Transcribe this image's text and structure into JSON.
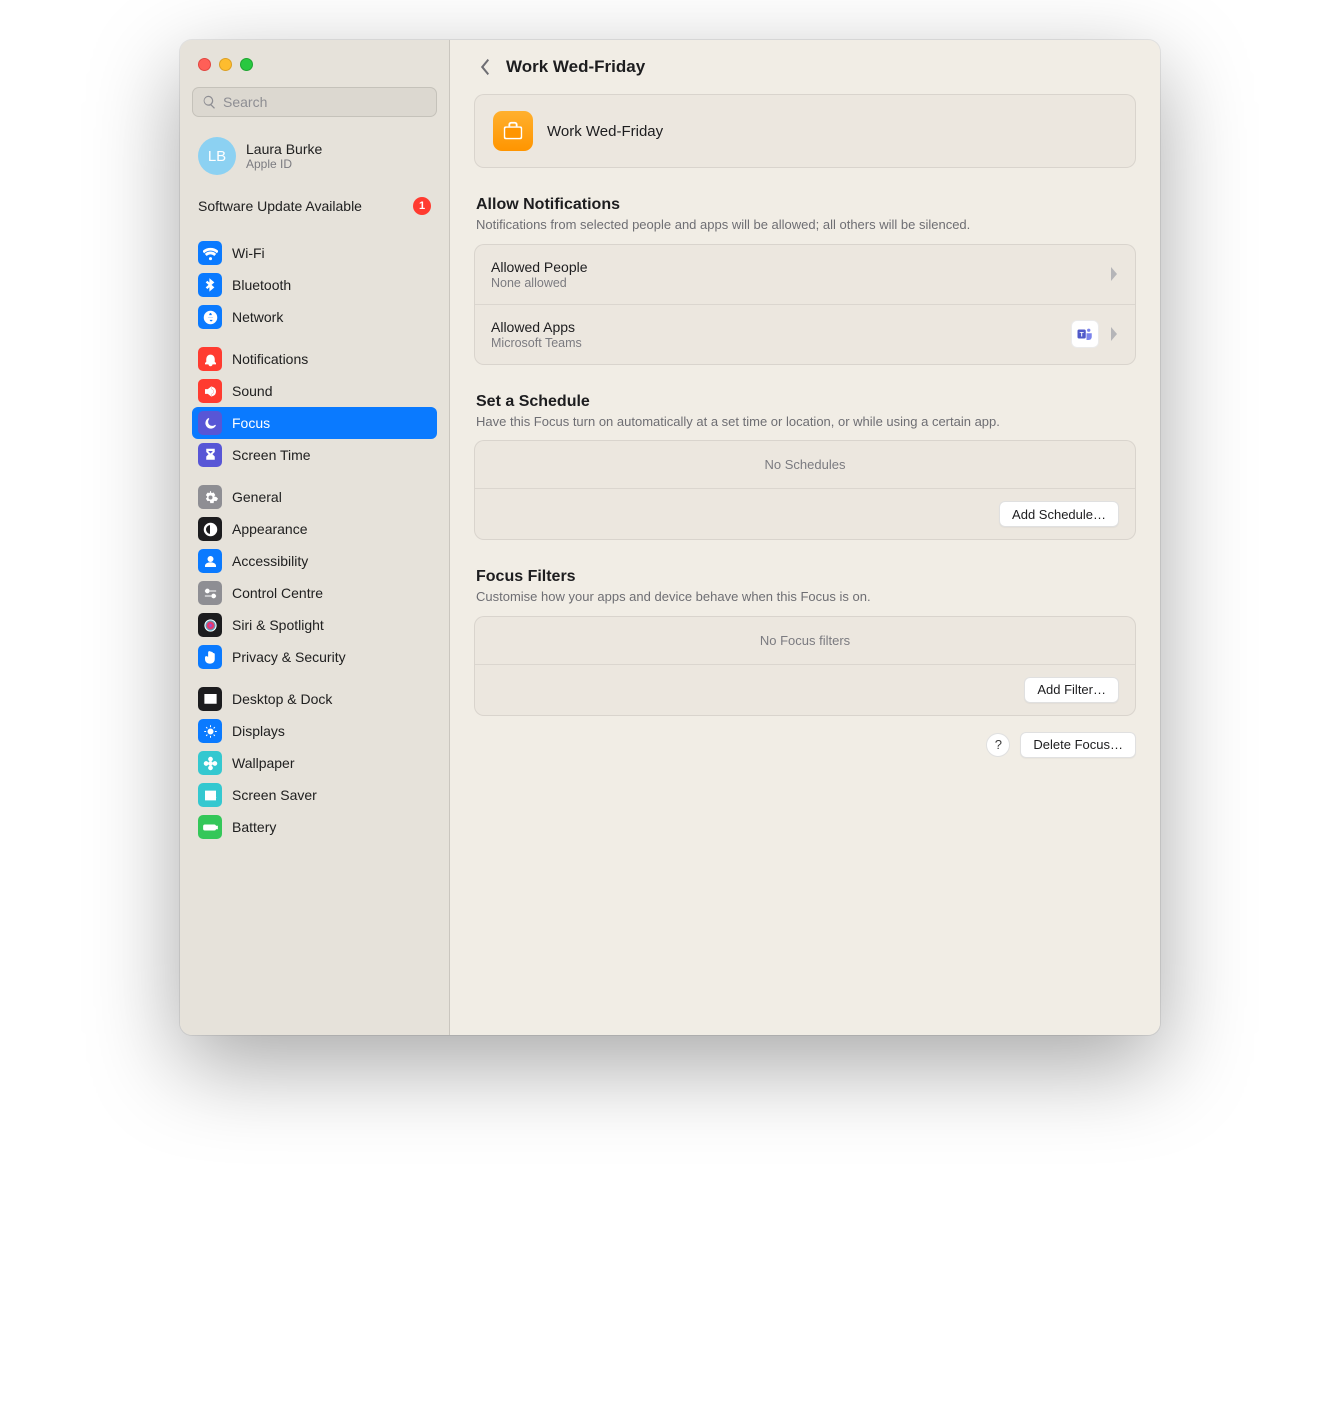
{
  "search": {
    "placeholder": "Search"
  },
  "account": {
    "initials": "LB",
    "name": "Laura Burke",
    "sub": "Apple ID"
  },
  "update": {
    "label": "Software Update Available",
    "badge": "1"
  },
  "sidebar": {
    "group1": [
      {
        "label": "Wi-Fi",
        "icon": "wifi",
        "color": "#0a7aff"
      },
      {
        "label": "Bluetooth",
        "icon": "bluetooth",
        "color": "#0a7aff"
      },
      {
        "label": "Network",
        "icon": "globe",
        "color": "#0a7aff"
      }
    ],
    "group2": [
      {
        "label": "Notifications",
        "icon": "bell",
        "color": "#ff3b30"
      },
      {
        "label": "Sound",
        "icon": "speaker",
        "color": "#ff3b30"
      },
      {
        "label": "Focus",
        "icon": "moon",
        "color": "#5856d6",
        "selected": true
      },
      {
        "label": "Screen Time",
        "icon": "hourglass",
        "color": "#5856d6"
      }
    ],
    "group3": [
      {
        "label": "General",
        "icon": "gear",
        "color": "#8e8e93"
      },
      {
        "label": "Appearance",
        "icon": "contrast",
        "color": "#1c1c1e"
      },
      {
        "label": "Accessibility",
        "icon": "person",
        "color": "#0a7aff"
      },
      {
        "label": "Control Centre",
        "icon": "switches",
        "color": "#8e8e93"
      },
      {
        "label": "Siri & Spotlight",
        "icon": "siri",
        "color": "#1c1c1e"
      },
      {
        "label": "Privacy & Security",
        "icon": "hand",
        "color": "#0a7aff"
      }
    ],
    "group4": [
      {
        "label": "Desktop & Dock",
        "icon": "dock",
        "color": "#1c1c1e"
      },
      {
        "label": "Displays",
        "icon": "sun",
        "color": "#0a7aff"
      },
      {
        "label": "Wallpaper",
        "icon": "flower",
        "color": "#34c8d0"
      },
      {
        "label": "Screen Saver",
        "icon": "photo",
        "color": "#34c8d0"
      },
      {
        "label": "Battery",
        "icon": "battery",
        "color": "#34c759"
      }
    ]
  },
  "header": {
    "title": "Work Wed-Friday"
  },
  "focus": {
    "name": "Work Wed-Friday"
  },
  "notifications": {
    "title": "Allow Notifications",
    "desc": "Notifications from selected people and apps will be allowed; all others will be silenced.",
    "people": {
      "title": "Allowed People",
      "sub": "None allowed"
    },
    "apps": {
      "title": "Allowed Apps",
      "sub": "Microsoft Teams"
    }
  },
  "schedule": {
    "title": "Set a Schedule",
    "desc": "Have this Focus turn on automatically at a set time or location, or while using a certain app.",
    "empty": "No Schedules",
    "add": "Add Schedule…"
  },
  "filters": {
    "title": "Focus Filters",
    "desc": "Customise how your apps and device behave when this Focus is on.",
    "empty": "No Focus filters",
    "add": "Add Filter…"
  },
  "footer": {
    "help": "?",
    "delete": "Delete Focus…"
  }
}
